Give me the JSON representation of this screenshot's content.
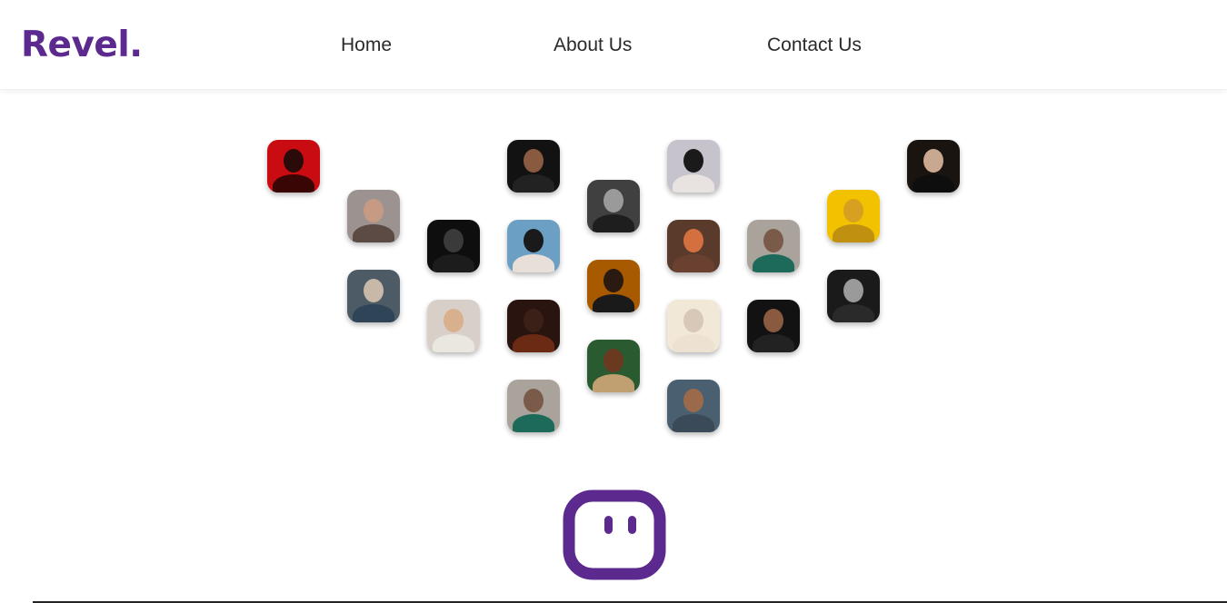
{
  "header": {
    "logo": "Revel.",
    "nav": [
      {
        "label": "Home"
      },
      {
        "label": "About Us"
      },
      {
        "label": "Contact Us"
      }
    ]
  },
  "colors": {
    "brand": "#5c2a8f",
    "nav_text": "#2a2a2a"
  },
  "avatars": [
    {
      "name": "avatar-woman-red-background",
      "bg": "#c90c12",
      "head": "#2b0a0a",
      "body": "#3a0505"
    },
    {
      "name": "avatar-woman-beanie",
      "bg": "#9c9391",
      "head": "#c79a84",
      "body": "#5c4a44"
    },
    {
      "name": "avatar-older-man-gray-hair",
      "bg": "#4d5b66",
      "head": "#c8b8a8",
      "body": "#2f4456"
    },
    {
      "name": "avatar-woman-black-and-white",
      "bg": "#0e0e0e",
      "head": "#3a3a3a",
      "body": "#1c1c1c"
    },
    {
      "name": "avatar-young-man-blond",
      "bg": "#d8d0c8",
      "head": "#d9b08e",
      "body": "#eae6e0"
    },
    {
      "name": "avatar-man-glasses-dark",
      "bg": "#121212",
      "head": "#8a5a40",
      "body": "#222222"
    },
    {
      "name": "avatar-woman-curly-hair-city",
      "bg": "#6b9fc4",
      "head": "#1a1a1a",
      "body": "#e8e0d8"
    },
    {
      "name": "avatar-man-sunglasses-jacket",
      "bg": "#2a1410",
      "head": "#3a2016",
      "body": "#6b2a14"
    },
    {
      "name": "avatar-man-cap-beard",
      "bg": "#a9a39c",
      "head": "#7a5a48",
      "body": "#1d6a5a"
    },
    {
      "name": "avatar-man-glasses-grayscale",
      "bg": "#404040",
      "head": "#9a9a9a",
      "body": "#1e1e1e"
    },
    {
      "name": "avatar-man-halo-light",
      "bg": "#a85a00",
      "head": "#2a1a10",
      "body": "#1a1a1a"
    },
    {
      "name": "avatar-woman-green-background",
      "bg": "#2a5a30",
      "head": "#6a3a20",
      "body": "#c0a070"
    },
    {
      "name": "avatar-woman-bob-hair",
      "bg": "#c7c3cc",
      "head": "#1a1a1a",
      "body": "#e8e2e0"
    },
    {
      "name": "avatar-woman-red-hair-smile",
      "bg": "#5a3a2a",
      "head": "#d47040",
      "body": "#6a4030"
    },
    {
      "name": "avatar-woman-profile-beige",
      "bg": "#f2e8d8",
      "head": "#d8c8b8",
      "body": "#ede2d2"
    },
    {
      "name": "avatar-man-glasses-beard",
      "bg": "#4a6070",
      "head": "#9a6a4a",
      "body": "#3a4a58"
    },
    {
      "name": "avatar-man-cap-beard-2",
      "bg": "#a9a39c",
      "head": "#7a5a48",
      "body": "#1d6a5a"
    },
    {
      "name": "avatar-man-glasses-dark-2",
      "bg": "#121212",
      "head": "#8a5a40",
      "body": "#222222"
    },
    {
      "name": "avatar-woman-yellow-paint",
      "bg": "#f2c200",
      "head": "#d8a020",
      "body": "#c09010"
    },
    {
      "name": "avatar-woman-glasses-grayscale",
      "bg": "#1a1a1a",
      "head": "#9a9a9a",
      "body": "#2a2a2a"
    },
    {
      "name": "avatar-woman-dark-portrait",
      "bg": "#1a1410",
      "head": "#c8a890",
      "body": "#0e0e0e"
    }
  ],
  "mascot": {
    "name": "mascot-face-icon",
    "color": "#5c2a8f"
  }
}
